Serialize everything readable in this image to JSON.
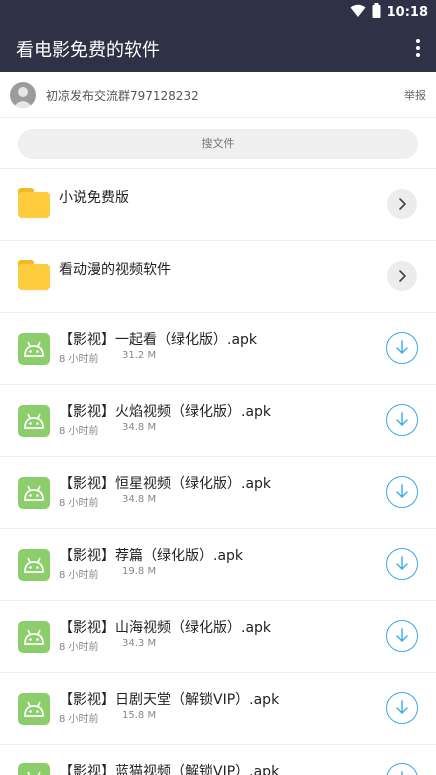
{
  "status_bar": {
    "time": "10:18",
    "wifi_icon": "wifi-icon",
    "battery_icon": "battery-icon"
  },
  "app_bar": {
    "title": "看电影免费的软件",
    "menu_icon": "more-vert-icon"
  },
  "owner": {
    "name": "初凉发布交流群797128232",
    "report_label": "举报"
  },
  "search": {
    "placeholder": "搜文件"
  },
  "folders": [
    {
      "name": "小说免费版"
    },
    {
      "name": "看动漫的视频软件"
    }
  ],
  "files": [
    {
      "name": "【影视】一起看（绿化版）.apk",
      "time": "8 小时前",
      "size": "31.2 M"
    },
    {
      "name": "【影视】火焰视频（绿化版）.apk",
      "time": "8 小时前",
      "size": "34.8 M"
    },
    {
      "name": "【影视】恒星视频（绿化版）.apk",
      "time": "8 小时前",
      "size": "34.8 M"
    },
    {
      "name": "【影视】荐篇（绿化版）.apk",
      "time": "8 小时前",
      "size": "19.8 M"
    },
    {
      "name": "【影视】山海视频（绿化版）.apk",
      "time": "8 小时前",
      "size": "34.3 M"
    },
    {
      "name": "【影视】日剧天堂（解锁VIP）.apk",
      "time": "8 小时前",
      "size": "15.8 M"
    },
    {
      "name": "【影视】蓝猫视频（解锁VIP）.apk",
      "time": "",
      "size": ""
    }
  ],
  "colors": {
    "app_bar": "#2f3246",
    "folder": "#ffcc3d",
    "apk_icon": "#8dce6c",
    "download_accent": "#39a9e8"
  }
}
